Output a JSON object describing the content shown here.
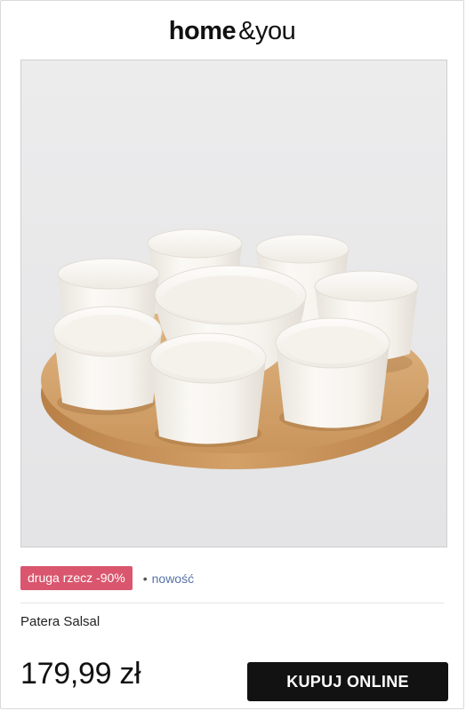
{
  "brand": {
    "part1": "home",
    "part2": "&",
    "part3": "you"
  },
  "product": {
    "image_alt": "Patera Salsal",
    "promo_badge": "druga rzecz -90%",
    "separator": "•",
    "status": "nowość",
    "name": "Patera Salsal",
    "price": "179,99 zł",
    "buy_label": "KUPUJ ONLINE"
  },
  "colors": {
    "promo_background": "#d9566e",
    "status_text": "#5672a6",
    "button_background": "#121212"
  }
}
